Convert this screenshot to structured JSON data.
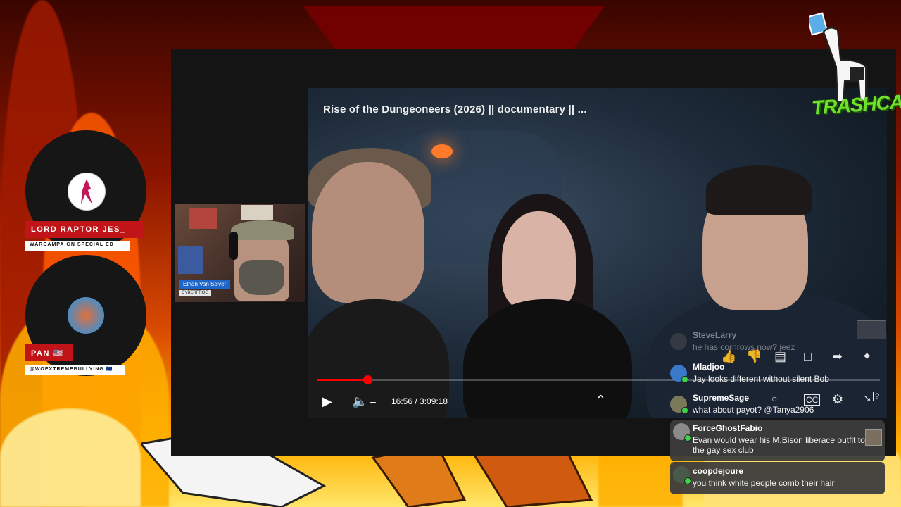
{
  "video": {
    "title": "Rise of the Dungeoneers (2026) || documentary || ...",
    "time": "16:56 / 3:09:18",
    "progress_fraction": 0.0896
  },
  "webcam": {
    "name": "Ethan Van Sciver",
    "subtitle": "CYBERFROG"
  },
  "speakers": [
    {
      "name": "LORD RAPTOR JES_",
      "tag": "WARCAMPAIGN SPECIAL ED"
    },
    {
      "name": "PAN 🇺🇸",
      "tag": "@WOEXTREMEBULLYING 🇪🇺"
    }
  ],
  "channel": {
    "logo_text": "TRASHCAST"
  },
  "chat": [
    {
      "user": "SteveLarry",
      "text": "he has cornrows now? jeez"
    },
    {
      "user": "Mladjoo",
      "text": "Jay looks different without silent Bob"
    },
    {
      "user": "SupremeSage",
      "text": "what about payot? @Tanya2906"
    },
    {
      "user": "ForceGhostFabio",
      "text": "Evan would wear his M.Bison liberace outfit to the gay sex club"
    },
    {
      "user": "coopdejoure",
      "text": "you think white people comb their hair"
    }
  ],
  "colors": {
    "accent_red": "#c01418",
    "progress_red": "#ff0000",
    "logo_green": "#6fe12a",
    "badge_blue": "#1e66c9"
  }
}
